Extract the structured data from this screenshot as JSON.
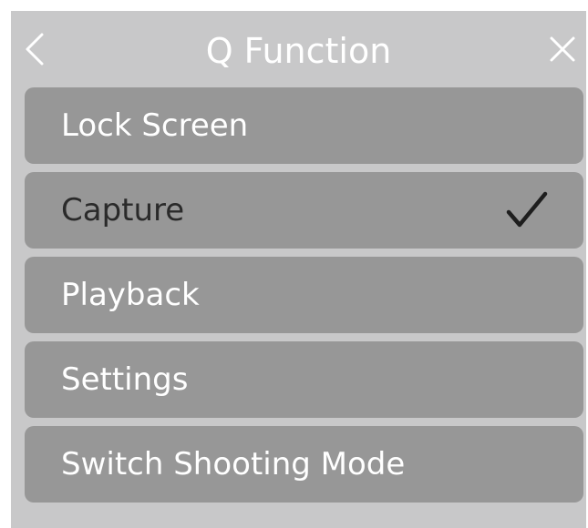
{
  "header": {
    "title": "Q Function",
    "back_icon": "chevron-left-icon",
    "close_icon": "close-icon"
  },
  "menu": {
    "items": [
      {
        "label": "Lock Screen",
        "selected": false
      },
      {
        "label": "Capture",
        "selected": true,
        "status_icon": "check-icon"
      },
      {
        "label": "Playback",
        "selected": false
      },
      {
        "label": "Settings",
        "selected": false
      },
      {
        "label": "Switch Shooting Mode",
        "selected": false
      }
    ]
  },
  "colors": {
    "panel_background": "#c8c8c9",
    "item_background": "#979797",
    "label_text": "#ffffff",
    "selected_label_text": "#2a2a2a"
  }
}
